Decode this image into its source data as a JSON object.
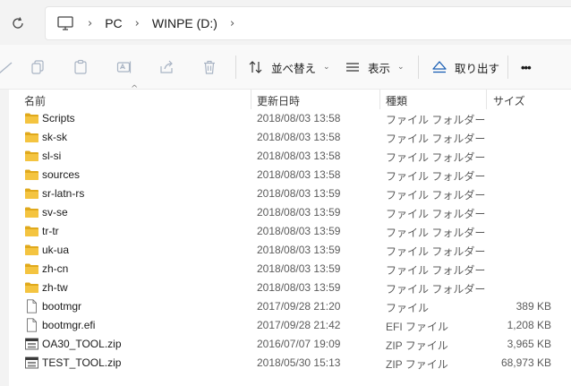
{
  "address_bar": {
    "crumbs": [
      "PC",
      "WINPE (D:)"
    ],
    "separator": "›"
  },
  "toolbar": {
    "sort_label": "並べ替え",
    "view_label": "表示",
    "eject_label": "取り出す",
    "more_label": "•••"
  },
  "columns": {
    "name": "名前",
    "date": "更新日時",
    "type": "種類",
    "size": "サイズ"
  },
  "files": [
    {
      "name": "Scripts",
      "date": "2018/08/03 13:58",
      "type": "ファイル フォルダー",
      "size": "",
      "icon": "folder-icon"
    },
    {
      "name": "sk-sk",
      "date": "2018/08/03 13:58",
      "type": "ファイル フォルダー",
      "size": "",
      "icon": "folder-icon"
    },
    {
      "name": "sl-si",
      "date": "2018/08/03 13:58",
      "type": "ファイル フォルダー",
      "size": "",
      "icon": "folder-icon"
    },
    {
      "name": "sources",
      "date": "2018/08/03 13:58",
      "type": "ファイル フォルダー",
      "size": "",
      "icon": "folder-icon"
    },
    {
      "name": "sr-latn-rs",
      "date": "2018/08/03 13:59",
      "type": "ファイル フォルダー",
      "size": "",
      "icon": "folder-icon"
    },
    {
      "name": "sv-se",
      "date": "2018/08/03 13:59",
      "type": "ファイル フォルダー",
      "size": "",
      "icon": "folder-icon"
    },
    {
      "name": "tr-tr",
      "date": "2018/08/03 13:59",
      "type": "ファイル フォルダー",
      "size": "",
      "icon": "folder-icon"
    },
    {
      "name": "uk-ua",
      "date": "2018/08/03 13:59",
      "type": "ファイル フォルダー",
      "size": "",
      "icon": "folder-icon"
    },
    {
      "name": "zh-cn",
      "date": "2018/08/03 13:59",
      "type": "ファイル フォルダー",
      "size": "",
      "icon": "folder-icon"
    },
    {
      "name": "zh-tw",
      "date": "2018/08/03 13:59",
      "type": "ファイル フォルダー",
      "size": "",
      "icon": "folder-icon"
    },
    {
      "name": "bootmgr",
      "date": "2017/09/28 21:20",
      "type": "ファイル",
      "size": "389 KB",
      "icon": "file-icon"
    },
    {
      "name": "bootmgr.efi",
      "date": "2017/09/28 21:42",
      "type": "EFI ファイル",
      "size": "1,208 KB",
      "icon": "file-icon"
    },
    {
      "name": "OA30_TOOL.zip",
      "date": "2016/07/07 19:09",
      "type": "ZIP ファイル",
      "size": "3,965 KB",
      "icon": "zip-icon"
    },
    {
      "name": "TEST_TOOL.zip",
      "date": "2018/05/30 15:13",
      "type": "ZIP ファイル",
      "size": "68,973 KB",
      "icon": "zip-icon"
    }
  ],
  "colors": {
    "folder": "#f4c440",
    "folder_dark": "#e0a91c",
    "toolbar_bg": "#f9f9f9",
    "disabled_icon": "#a9b4c4",
    "accent": "#1a5fb4"
  }
}
